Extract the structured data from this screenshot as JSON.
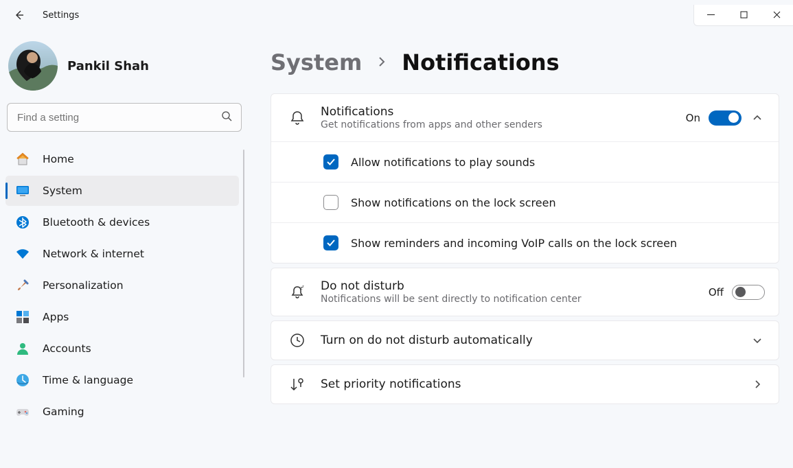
{
  "window": {
    "title": "Settings"
  },
  "profile": {
    "name": "Pankil Shah"
  },
  "search": {
    "placeholder": "Find a setting"
  },
  "nav": {
    "items": [
      {
        "id": "home",
        "label": "Home"
      },
      {
        "id": "system",
        "label": "System"
      },
      {
        "id": "bluetooth",
        "label": "Bluetooth & devices"
      },
      {
        "id": "network",
        "label": "Network & internet"
      },
      {
        "id": "personalization",
        "label": "Personalization"
      },
      {
        "id": "apps",
        "label": "Apps"
      },
      {
        "id": "accounts",
        "label": "Accounts"
      },
      {
        "id": "time",
        "label": "Time & language"
      },
      {
        "id": "gaming",
        "label": "Gaming"
      }
    ],
    "active": "system"
  },
  "breadcrumb": {
    "parent": "System",
    "current": "Notifications"
  },
  "panel": {
    "notifications": {
      "title": "Notifications",
      "sub": "Get notifications from apps and other senders",
      "state_label": "On",
      "on": true,
      "options": [
        {
          "label": "Allow notifications to play sounds",
          "checked": true
        },
        {
          "label": "Show notifications on the lock screen",
          "checked": false
        },
        {
          "label": "Show reminders and incoming VoIP calls on the lock screen",
          "checked": true
        }
      ]
    },
    "dnd": {
      "title": "Do not disturb",
      "sub": "Notifications will be sent directly to notification center",
      "state_label": "Off",
      "on": false
    },
    "auto_dnd": {
      "title": "Turn on do not disturb automatically"
    },
    "priority": {
      "title": "Set priority notifications"
    }
  }
}
